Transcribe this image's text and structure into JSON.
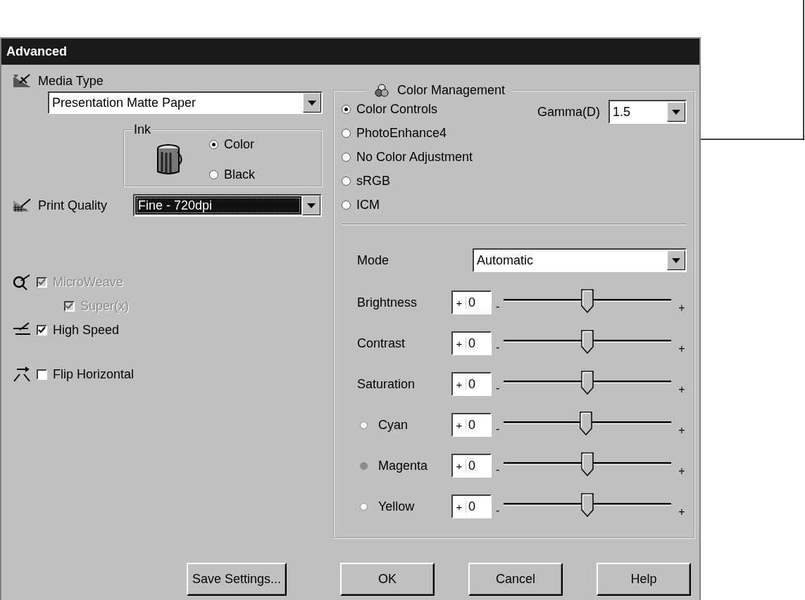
{
  "window": {
    "title": "Advanced"
  },
  "media_type": {
    "label": "Media Type",
    "value": "Presentation Matte Paper"
  },
  "ink": {
    "label": "Ink",
    "options": [
      {
        "label": "Color",
        "selected": true
      },
      {
        "label": "Black",
        "selected": false
      }
    ]
  },
  "print_quality": {
    "label": "Print Quality",
    "value": "Fine - 720dpi",
    "focused": true
  },
  "options": [
    {
      "kind": "microweave",
      "label": "MicroWeave",
      "checked": true,
      "disabled": true,
      "children": [
        {
          "label": "Super(x)",
          "checked": true,
          "disabled": true
        }
      ]
    },
    {
      "kind": "speed",
      "label": "High Speed",
      "checked": true,
      "disabled": false
    },
    {
      "kind": "flip",
      "label": "Flip Horizontal",
      "checked": false,
      "disabled": false
    }
  ],
  "color_management": {
    "title": "Color Management",
    "modes": [
      {
        "label": "Color Controls",
        "selected": true
      },
      {
        "label": "PhotoEnhance4",
        "selected": false
      },
      {
        "label": "No Color Adjustment",
        "selected": false
      },
      {
        "label": "sRGB",
        "selected": false
      },
      {
        "label": "ICM",
        "selected": false
      }
    ],
    "gamma": {
      "label": "Gamma(D)",
      "value": "1.5"
    },
    "mode": {
      "label": "Mode",
      "value": "Automatic"
    },
    "adjustments": [
      {
        "label": "Brightness",
        "sign": "+",
        "value": "0",
        "level": 0.5,
        "min_label": "-",
        "max_label": "+"
      },
      {
        "label": "Contrast",
        "sign": "+",
        "value": "0",
        "level": 0.5,
        "min_label": "-",
        "max_label": "+"
      },
      {
        "label": "Saturation",
        "sign": "+",
        "value": "0",
        "level": 0.5,
        "min_label": "-",
        "max_label": "+"
      },
      {
        "label": "Cyan",
        "sign": "+",
        "value": "0",
        "level": 0.49,
        "min_label": "-",
        "max_label": "+",
        "color": "#f4f4f4"
      },
      {
        "label": "Magenta",
        "sign": "+",
        "value": "0",
        "level": 0.5,
        "min_label": "-",
        "max_label": "+",
        "color": "#8c8c8c"
      },
      {
        "label": "Yellow",
        "sign": "+",
        "value": "0",
        "level": 0.5,
        "min_label": "-",
        "max_label": "+",
        "color": "#ffffff"
      }
    ]
  },
  "buttons": [
    "Save Settings...",
    "OK",
    "Cancel",
    "Help"
  ]
}
